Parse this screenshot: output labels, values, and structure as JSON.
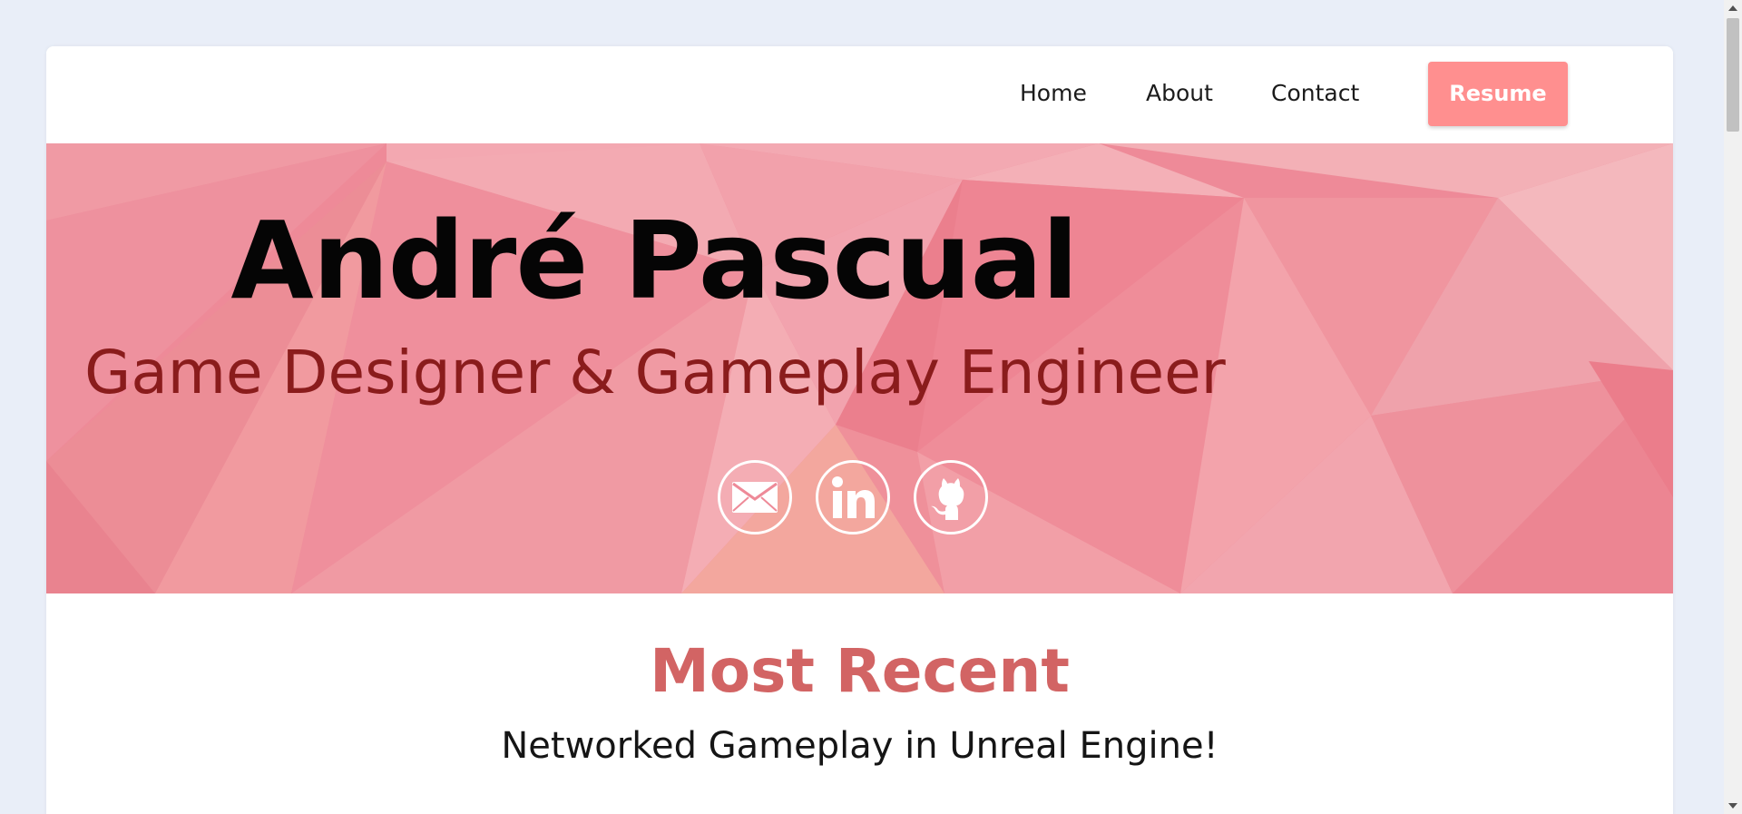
{
  "nav": {
    "links": [
      "Home",
      "About",
      "Contact"
    ],
    "resume_label": "Resume"
  },
  "hero": {
    "name": "André Pascual",
    "subtitle": "Game Designer & Gameplay Engineer",
    "social": [
      "mail-icon",
      "linkedin-icon",
      "github-icon"
    ]
  },
  "recent": {
    "title": "Most Recent",
    "subtitle": "Networked Gameplay in Unreal Engine!"
  },
  "colors": {
    "page_bg": "#e9eef8",
    "hero_pink": "#ee8a98",
    "accent": "#ff8f8f",
    "subtitle_red": "#8a1c1c",
    "recent_title": "#d26464"
  }
}
